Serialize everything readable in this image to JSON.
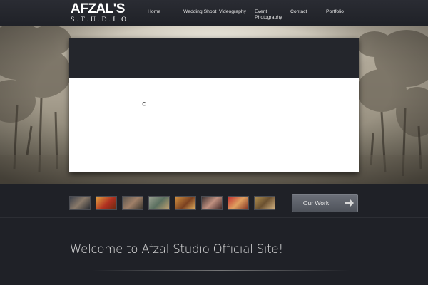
{
  "brand": {
    "name": "AFZAL'S",
    "tagline": "S.T.U.D.I.O"
  },
  "nav": {
    "items": [
      {
        "label": "Home"
      },
      {
        "label": "Wedding Shoot"
      },
      {
        "label": "Videography"
      },
      {
        "label": "Event Photography"
      },
      {
        "label": "Contact"
      },
      {
        "label": "Portfolio"
      }
    ]
  },
  "slider": {
    "state": "loading"
  },
  "thumbnails": {
    "count": 8
  },
  "cta": {
    "label": "Our Work",
    "icon": "arrow-right-icon"
  },
  "welcome": {
    "title": "Welcome to Afzal Studio Official Site!"
  },
  "colors": {
    "background": "#1f2127",
    "accent_star": "#d32020",
    "button": "#5c6068"
  }
}
